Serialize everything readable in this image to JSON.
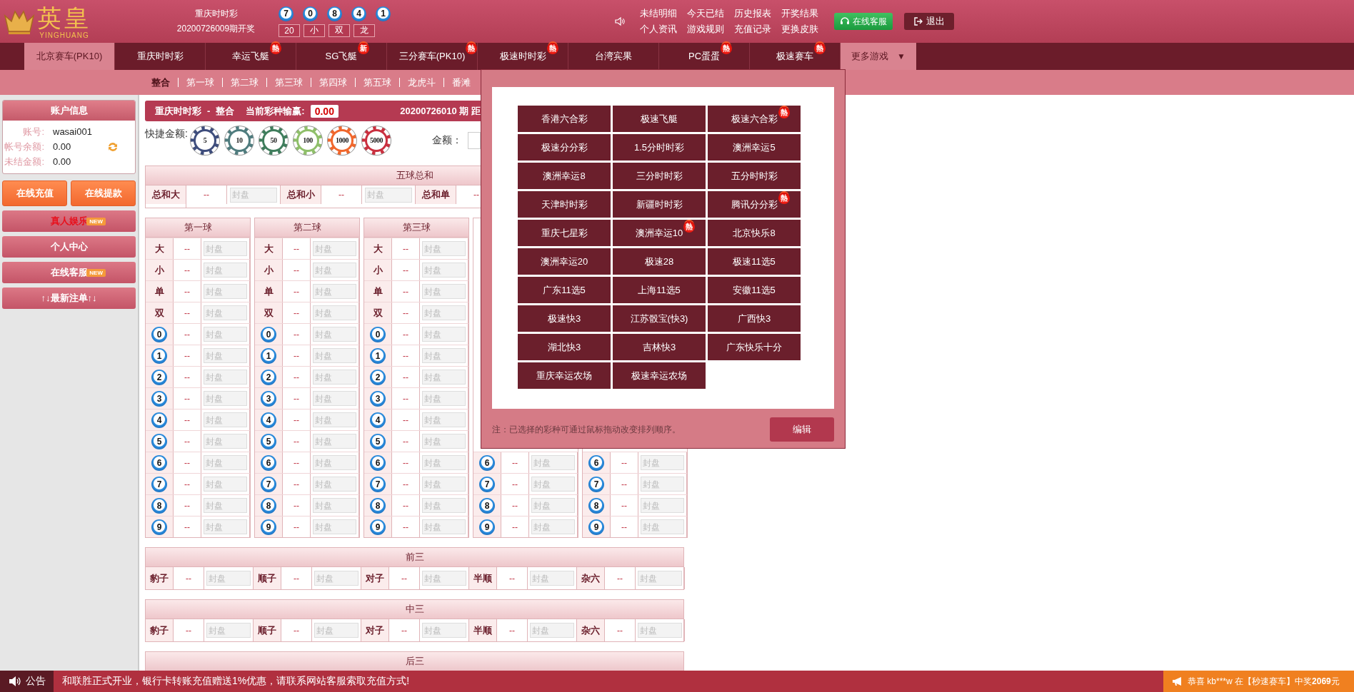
{
  "header": {
    "logo": {
      "title": "英皇",
      "subtitle": "YINGHUANG"
    },
    "draw": {
      "game": "重庆时时彩",
      "period": "20200726009期开奖",
      "balls": [
        "7",
        "0",
        "8",
        "4",
        "1"
      ],
      "results": [
        "20",
        "小",
        "双",
        "龙"
      ]
    },
    "links": [
      "未结明细",
      "今天已结",
      "历史报表",
      "开奖结果",
      "个人资讯",
      "游戏规则",
      "充值记录",
      "更换皮肤"
    ],
    "service_button": "在线客服",
    "logout_button": "退出"
  },
  "nav_tabs": [
    {
      "label": "北京赛车(PK10)",
      "selected": true
    },
    {
      "label": "重庆时时彩",
      "selected": false
    },
    {
      "label": "幸运飞艇",
      "selected": false,
      "badge": "熱"
    },
    {
      "label": "SG飞艇",
      "selected": false,
      "badge": "新"
    },
    {
      "label": "三分赛车(PK10)",
      "selected": false,
      "badge": "熱"
    },
    {
      "label": "极速时时彩",
      "selected": false,
      "badge": "熱"
    },
    {
      "label": "台湾宾果",
      "selected": false
    },
    {
      "label": "PC蛋蛋",
      "selected": false,
      "badge": "熱"
    },
    {
      "label": "极速赛车",
      "selected": false,
      "badge": "熱"
    }
  ],
  "more_games": {
    "label": "更多游戏",
    "caret": "▼",
    "expanded": true
  },
  "sub_tabs": [
    {
      "label": "整合",
      "selected": true
    },
    {
      "label": "第一球",
      "selected": false
    },
    {
      "label": "第二球",
      "selected": false
    },
    {
      "label": "第三球",
      "selected": false
    },
    {
      "label": "第四球",
      "selected": false
    },
    {
      "label": "第五球",
      "selected": false
    },
    {
      "label": "龙虎斗",
      "selected": false
    },
    {
      "label": "番滩",
      "selected": false
    }
  ],
  "sidebar": {
    "account": {
      "title": "账户信息",
      "fields": [
        {
          "label": "账号:",
          "value": "wasai001",
          "refresh": false
        },
        {
          "label": "帐号余额:",
          "value": "0.00",
          "refresh": true
        },
        {
          "label": "未结金额:",
          "value": "0.00",
          "refresh": false
        }
      ]
    },
    "buttons": [
      "在线充值",
      "在线提款"
    ],
    "menu": [
      {
        "label": "真人娱乐",
        "highlight": true,
        "badge": "NEW"
      },
      {
        "label": "个人中心",
        "highlight": false
      },
      {
        "label": "在线客服",
        "highlight": false,
        "badge": "NEW"
      },
      {
        "label": "↑↓最新注单↑↓",
        "highlight": false
      }
    ]
  },
  "main": {
    "title_bar": {
      "game": "重庆时时彩",
      "separator": "-",
      "mode": "整合",
      "winloss_label": "当前彩种输赢:",
      "winloss": "0.00",
      "period": "20200726010 期 距"
    },
    "quick_amount": {
      "label": "快捷金额:",
      "chips": [
        {
          "value": "5",
          "color": "#3e4d7c"
        },
        {
          "value": "10",
          "color": "#4f7c7e"
        },
        {
          "value": "50",
          "color": "#3f7d5c"
        },
        {
          "value": "100",
          "color": "#8fbf6a"
        },
        {
          "value": "1000",
          "color": "#f0672c"
        },
        {
          "value": "5000",
          "color": "#c9303f"
        }
      ]
    },
    "amount_label": "金额：",
    "sum_table": {
      "title": "五球总和",
      "cells": [
        {
          "name": "总和大",
          "odds": "--",
          "placeholder": "封盘"
        },
        {
          "name": "总和小",
          "odds": "--",
          "placeholder": "封盘"
        },
        {
          "name": "总和单",
          "odds": "--"
        }
      ]
    },
    "ball_columns": [
      {
        "title": "第一球",
        "rows": [
          {
            "kind": "text",
            "label": "大",
            "odds": "--",
            "placeholder": "封盘"
          },
          {
            "kind": "text",
            "label": "小",
            "odds": "--",
            "placeholder": "封盘"
          },
          {
            "kind": "text",
            "label": "单",
            "odds": "--",
            "placeholder": "封盘"
          },
          {
            "kind": "text",
            "label": "双",
            "odds": "--",
            "placeholder": "封盘"
          },
          {
            "kind": "ball",
            "label": "0",
            "odds": "--",
            "placeholder": "封盘"
          },
          {
            "kind": "ball",
            "label": "1",
            "odds": "--",
            "placeholder": "封盘"
          },
          {
            "kind": "ball",
            "label": "2",
            "odds": "--",
            "placeholder": "封盘"
          },
          {
            "kind": "ball",
            "label": "3",
            "odds": "--",
            "placeholder": "封盘"
          },
          {
            "kind": "ball",
            "label": "4",
            "odds": "--",
            "placeholder": "封盘"
          },
          {
            "kind": "ball",
            "label": "5",
            "odds": "--",
            "placeholder": "封盘"
          },
          {
            "kind": "ball",
            "label": "6",
            "odds": "--",
            "placeholder": "封盘"
          },
          {
            "kind": "ball",
            "label": "7",
            "odds": "--",
            "placeholder": "封盘"
          },
          {
            "kind": "ball",
            "label": "8",
            "odds": "--",
            "placeholder": "封盘"
          },
          {
            "kind": "ball",
            "label": "9",
            "odds": "--",
            "placeholder": "封盘"
          }
        ]
      },
      {
        "title": "第二球",
        "rows": [
          {
            "kind": "text",
            "label": "大",
            "odds": "--",
            "placeholder": "封盘"
          },
          {
            "kind": "text",
            "label": "小",
            "odds": "--",
            "placeholder": "封盘"
          },
          {
            "kind": "text",
            "label": "单",
            "odds": "--",
            "placeholder": "封盘"
          },
          {
            "kind": "text",
            "label": "双",
            "odds": "--",
            "placeholder": "封盘"
          },
          {
            "kind": "ball",
            "label": "0",
            "odds": "--",
            "placeholder": "封盘"
          },
          {
            "kind": "ball",
            "label": "1",
            "odds": "--",
            "placeholder": "封盘"
          },
          {
            "kind": "ball",
            "label": "2",
            "odds": "--",
            "placeholder": "封盘"
          },
          {
            "kind": "ball",
            "label": "3",
            "odds": "--",
            "placeholder": "封盘"
          },
          {
            "kind": "ball",
            "label": "4",
            "odds": "--",
            "placeholder": "封盘"
          },
          {
            "kind": "ball",
            "label": "5",
            "odds": "--",
            "placeholder": "封盘"
          },
          {
            "kind": "ball",
            "label": "6",
            "odds": "--",
            "placeholder": "封盘"
          },
          {
            "kind": "ball",
            "label": "7",
            "odds": "--",
            "placeholder": "封盘"
          },
          {
            "kind": "ball",
            "label": "8",
            "odds": "--",
            "placeholder": "封盘"
          },
          {
            "kind": "ball",
            "label": "9",
            "odds": "--",
            "placeholder": "封盘"
          }
        ]
      },
      {
        "title": "第三球",
        "rows": [
          {
            "kind": "text",
            "label": "大",
            "odds": "--",
            "placeholder": "封盘"
          },
          {
            "kind": "text",
            "label": "小",
            "odds": "--",
            "placeholder": "封盘"
          },
          {
            "kind": "text",
            "label": "单",
            "odds": "--",
            "placeholder": "封盘"
          },
          {
            "kind": "text",
            "label": "双",
            "odds": "--",
            "placeholder": "封盘"
          },
          {
            "kind": "ball",
            "label": "0",
            "odds": "--",
            "placeholder": "封盘"
          },
          {
            "kind": "ball",
            "label": "1",
            "odds": "--",
            "placeholder": "封盘"
          },
          {
            "kind": "ball",
            "label": "2",
            "odds": "--",
            "placeholder": "封盘"
          },
          {
            "kind": "ball",
            "label": "3",
            "odds": "--",
            "placeholder": "封盘"
          },
          {
            "kind": "ball",
            "label": "4",
            "odds": "--",
            "placeholder": "封盘"
          },
          {
            "kind": "ball",
            "label": "5",
            "odds": "--",
            "placeholder": "封盘"
          },
          {
            "kind": "ball",
            "label": "6",
            "odds": "--",
            "placeholder": "封盘"
          },
          {
            "kind": "ball",
            "label": "7",
            "odds": "--",
            "placeholder": "封盘"
          },
          {
            "kind": "ball",
            "label": "8",
            "odds": "--",
            "placeholder": "封盘"
          },
          {
            "kind": "ball",
            "label": "9",
            "odds": "--",
            "placeholder": "封盘"
          }
        ]
      },
      {
        "rows": [
          {
            "kind": "ball",
            "label": "6",
            "odds": "--",
            "placeholder": "封盘"
          },
          {
            "kind": "ball",
            "label": "7",
            "odds": "--",
            "placeholder": "封盘"
          },
          {
            "kind": "ball",
            "label": "8",
            "odds": "--",
            "placeholder": "封盘"
          },
          {
            "kind": "ball",
            "label": "9",
            "odds": "--",
            "placeholder": "封盘"
          }
        ]
      },
      {
        "rows": [
          {
            "kind": "ball",
            "label": "6",
            "odds": "--",
            "placeholder": "封盘"
          },
          {
            "kind": "ball",
            "label": "7",
            "odds": "--",
            "placeholder": "封盘"
          },
          {
            "kind": "ball",
            "label": "8",
            "odds": "--",
            "placeholder": "封盘"
          },
          {
            "kind": "ball",
            "label": "9",
            "odds": "--",
            "placeholder": "封盘"
          }
        ]
      }
    ],
    "combo_tables": [
      {
        "title": "前三",
        "cells": [
          {
            "name": "豹子",
            "odds": "--",
            "placeholder": "封盘"
          },
          {
            "name": "顺子",
            "odds": "--",
            "placeholder": "封盘"
          },
          {
            "name": "对子",
            "odds": "--",
            "placeholder": "封盘"
          },
          {
            "name": "半顺",
            "odds": "--",
            "placeholder": "封盘"
          },
          {
            "name": "杂六",
            "odds": "--",
            "placeholder": "封盘"
          }
        ]
      },
      {
        "title": "中三",
        "cells": [
          {
            "name": "豹子",
            "odds": "--",
            "placeholder": "封盘"
          },
          {
            "name": "顺子",
            "odds": "--",
            "placeholder": "封盘"
          },
          {
            "name": "对子",
            "odds": "--",
            "placeholder": "封盘"
          },
          {
            "name": "半顺",
            "odds": "--",
            "placeholder": "封盘"
          },
          {
            "name": "杂六",
            "odds": "--",
            "placeholder": "封盘"
          }
        ]
      },
      {
        "title": "后三"
      }
    ]
  },
  "games_popup": {
    "games": [
      {
        "label": "香港六合彩"
      },
      {
        "label": "极速飞艇"
      },
      {
        "label": "极速六合彩",
        "badge": "熱"
      },
      {
        "label": "极速分分彩"
      },
      {
        "label": "1.5分时时彩"
      },
      {
        "label": "澳洲幸运5"
      },
      {
        "label": "澳洲幸运8"
      },
      {
        "label": "三分时时彩"
      },
      {
        "label": "五分时时彩"
      },
      {
        "label": "天津时时彩"
      },
      {
        "label": "新疆时时彩"
      },
      {
        "label": "腾讯分分彩",
        "badge": "熱"
      },
      {
        "label": "重庆七星彩"
      },
      {
        "label": "澳洲幸运10",
        "badge": "熱"
      },
      {
        "label": "北京快乐8"
      },
      {
        "label": "澳洲幸运20"
      },
      {
        "label": "极速28"
      },
      {
        "label": "极速11选5"
      },
      {
        "label": "广东11选5"
      },
      {
        "label": "上海11选5"
      },
      {
        "label": "安徽11选5"
      },
      {
        "label": "极速快3"
      },
      {
        "label": "江苏骰宝(快3)"
      },
      {
        "label": "广西快3"
      },
      {
        "label": "湖北快3"
      },
      {
        "label": "吉林快3"
      },
      {
        "label": "广东快乐十分"
      },
      {
        "label": "重庆幸运农场"
      },
      {
        "label": "极速幸运农场"
      }
    ],
    "note": "注：已选择的彩种可通过鼠标拖动改变排列顺序。",
    "edit_button": "编辑"
  },
  "footer": {
    "label": "公告",
    "message": "和联胜正式开业，银行卡转账充值赠送1%优惠，请联系网站客服索取充值方式!",
    "winner": {
      "before": "恭喜 kb***w 在【秒速赛车】中奖",
      "amount": "2069",
      "after": "元"
    }
  }
}
